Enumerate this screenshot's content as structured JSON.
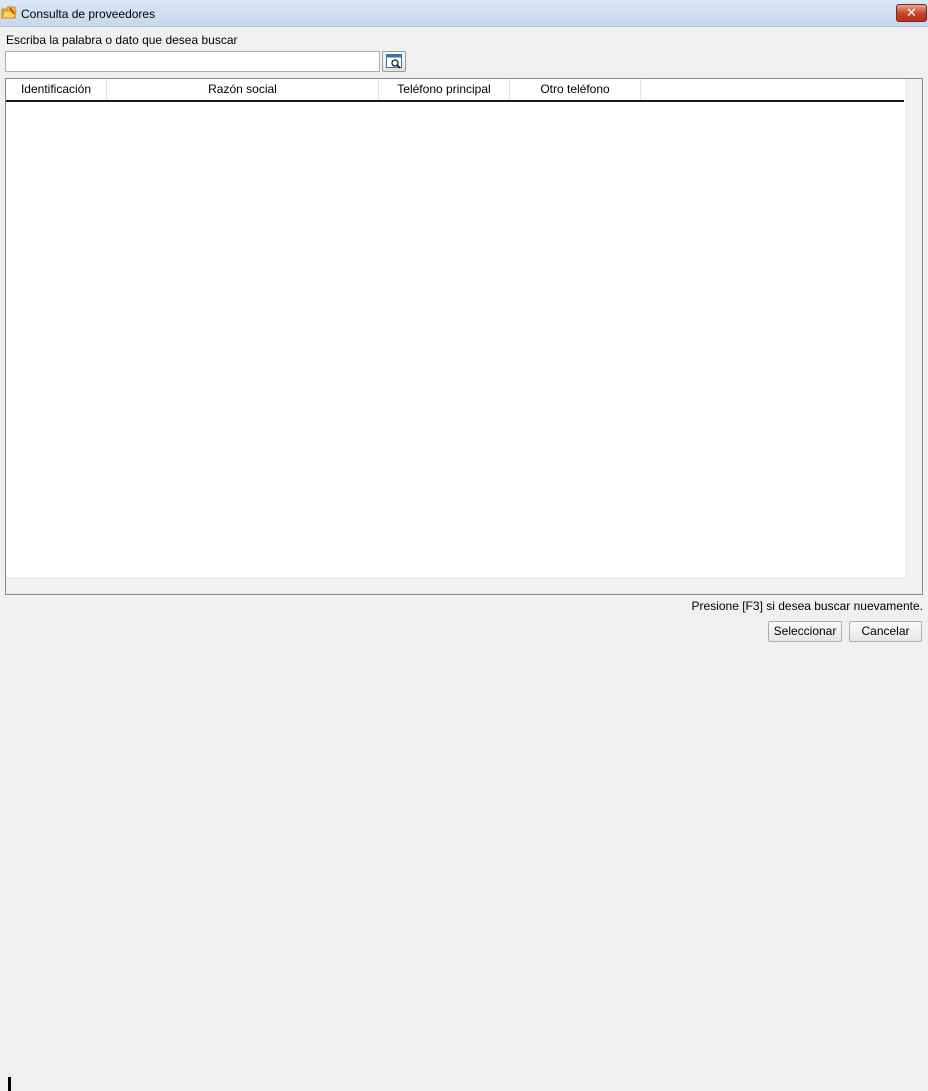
{
  "window": {
    "title": "Consulta de proveedores",
    "close_glyph": "✕"
  },
  "search": {
    "label": "Escriba la palabra o dato que desea buscar",
    "value": "",
    "placeholder": "",
    "button_icon": "search-window-icon"
  },
  "table": {
    "columns": [
      "Identificación",
      "Razón social",
      "Teléfono principal",
      "Otro teléfono"
    ],
    "rows": []
  },
  "footer": {
    "hint": "Presione [F3] si desea buscar nuevamente.",
    "select_label": "Seleccionar",
    "cancel_label": "Cancelar"
  },
  "colors": {
    "title_bar": "#c6d8ee",
    "close_button": "#c7402a",
    "window_background": "#f0f0f0"
  }
}
